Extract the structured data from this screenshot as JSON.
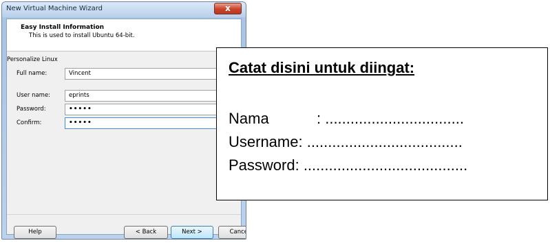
{
  "window": {
    "title": "New Virtual Machine Wizard",
    "close_label": "x"
  },
  "header": {
    "title": "Easy Install Information",
    "subtitle": "This is used to install Ubuntu 64-bit."
  },
  "section": {
    "label": "Personalize Linux"
  },
  "fields": {
    "full_name": {
      "label": "Full name:",
      "value": "Vincent"
    },
    "user_name": {
      "label": "User name:",
      "value": "eprints"
    },
    "password": {
      "label": "Password:",
      "value": "•••••"
    },
    "confirm": {
      "label": "Confirm:",
      "value": "•••••"
    }
  },
  "buttons": {
    "help": "Help",
    "back": "< Back",
    "next": "Next >",
    "cancel": "Cancel"
  },
  "note": {
    "title": "Catat disini untuk diingat:",
    "rows": [
      {
        "label": "Nama",
        "sep": ": ................................."
      },
      {
        "label": "Username",
        "sep": ": ....................................."
      },
      {
        "label": "Password",
        "sep": " : ......................................."
      }
    ]
  }
}
